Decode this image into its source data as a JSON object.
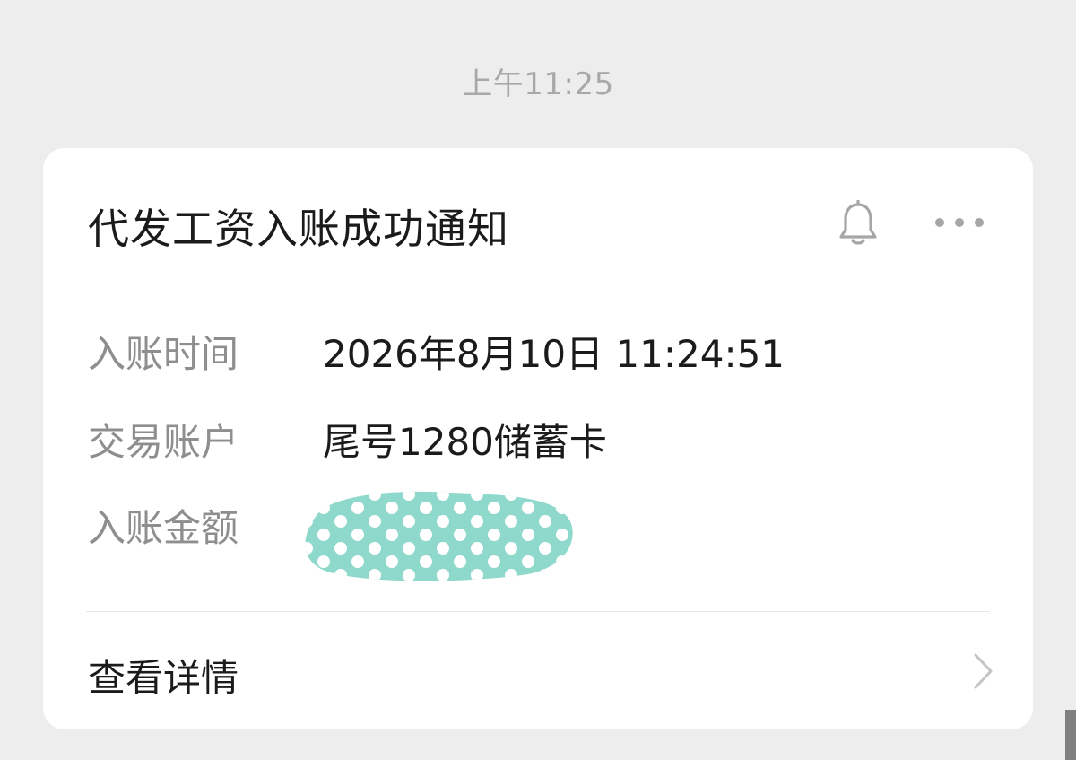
{
  "header": {
    "timestamp": "上午11:25"
  },
  "card": {
    "title": "代发工资入账成功通知",
    "icons": {
      "bell": "bell-icon",
      "more": "more-icon",
      "chevron": "chevron-right-icon"
    },
    "rows": [
      {
        "label": "入账时间",
        "value": "2026年8月10日 11:24:51"
      },
      {
        "label": "交易账户",
        "value": "尾号1280储蓄卡"
      },
      {
        "label": "入账金额",
        "value": ""
      }
    ],
    "details_label": "查看详情"
  },
  "colors": {
    "background": "#ededed",
    "card": "#ffffff",
    "label_text": "#8e8e8e",
    "value_text": "#1b1b1b",
    "mask": "#8fd8cc"
  }
}
